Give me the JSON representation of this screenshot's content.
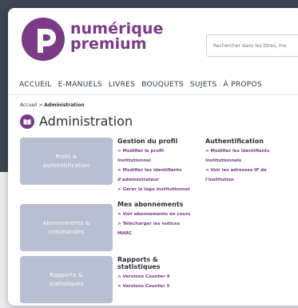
{
  "brand": {
    "line1": "numérique",
    "line2": "premium",
    "color": "#7b3a86"
  },
  "search": {
    "placeholder": "Rechercher dans les titres, mo"
  },
  "nav": {
    "items": [
      "ACCUEIL",
      "E-MANUELS",
      "LIVRES",
      "BOUQUETS",
      "SUJETS",
      "À PROPOS"
    ]
  },
  "breadcrumb": {
    "home": "Accueil",
    "separator": " > ",
    "current": "Administration"
  },
  "page": {
    "title": "Administration",
    "icon": "book-icon"
  },
  "sections": [
    {
      "block_label": "Profil &\nauthentification",
      "columns": [
        {
          "heading": "Gestion du profil",
          "links": [
            "> Modifier le profil\ninstitutionnel",
            "> Modifier les identifiants\nd'administrateur",
            "> Gérer le logo institutionnel"
          ]
        },
        {
          "heading": "Authentification",
          "links": [
            "> Modifier les identifiants\ninstitutionnels",
            "> Voir les adresses IP de\nl'institution"
          ]
        }
      ]
    },
    {
      "block_label": "Abonnements &\ncommandes",
      "columns": [
        {
          "heading": "Mes abonnements",
          "links": [
            "> Voir abonnements en cours",
            "> Télécharger les notices\nMARC"
          ]
        }
      ]
    },
    {
      "block_label": "Rapports &\nstatistiques",
      "columns": [
        {
          "heading": "Rapports &\nstatistiques",
          "links": [
            "> Versions Counter 4",
            "> Versions Counter 5"
          ]
        }
      ]
    }
  ],
  "colors": {
    "accent": "#7b3a86",
    "block": "#b9bfd2",
    "background_dark": "#3b4652"
  }
}
